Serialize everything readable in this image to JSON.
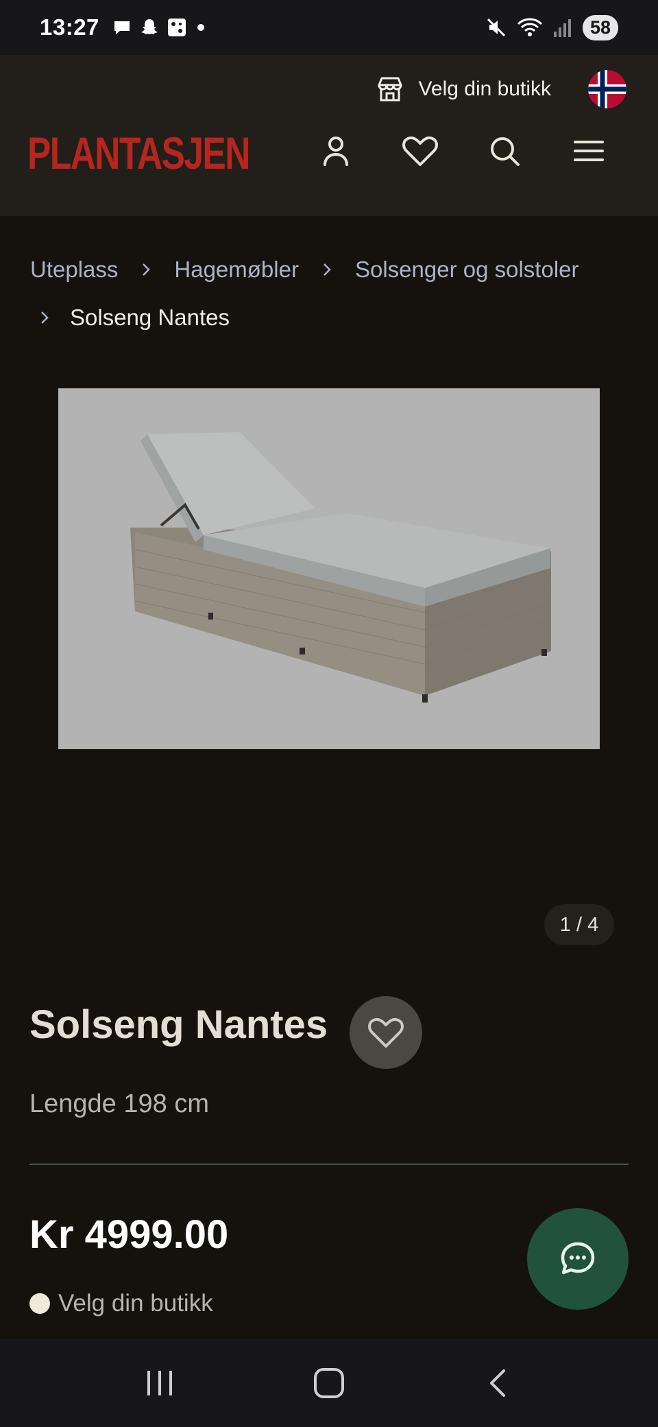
{
  "status_bar": {
    "time": "13:27",
    "battery": "58"
  },
  "header": {
    "store_button_label": "Velg din butikk",
    "logo_text": "PLANTASJEN",
    "icons": [
      "store-icon",
      "norway-flag-icon",
      "account-icon",
      "favorites-icon",
      "search-icon",
      "menu-icon"
    ],
    "logo_color": "#b7261e"
  },
  "breadcrumb": {
    "items": [
      "Uteplass",
      "Hagemøbler",
      "Solsenger og solstoler",
      "Solseng Nantes"
    ]
  },
  "gallery": {
    "counter": "1 / 4",
    "current_image": 1,
    "total_images": 4
  },
  "product": {
    "title": "Solseng Nantes",
    "subtitle": "Lengde 198 cm",
    "price": "Kr 4999.00",
    "store_status": "Velg din butikk"
  },
  "colors": {
    "page_bg": "#15120e",
    "header_bg": "#221f1a",
    "chat_button": "#21533c",
    "divider": "#3c5a47"
  }
}
